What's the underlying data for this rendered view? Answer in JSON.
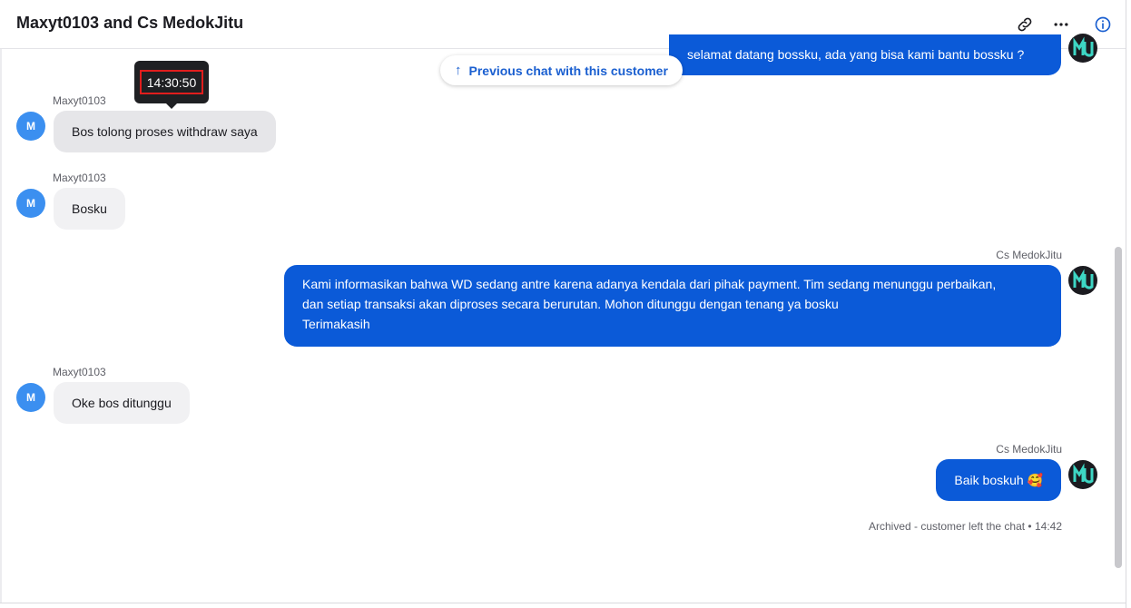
{
  "header": {
    "title": "Maxyt0103 and Cs MedokJitu"
  },
  "previous_chat": {
    "label": "Previous chat with this customer"
  },
  "tooltip": {
    "time": "14:30:50"
  },
  "messages": [
    {
      "author": "Cs MedokJitu",
      "text": "selamat datang bossku, ada yang bisa kami bantu bossku ?"
    },
    {
      "author": "Maxyt0103",
      "text": "Bos tolong proses withdraw saya"
    },
    {
      "author": "Maxyt0103",
      "text": "Bosku"
    },
    {
      "author": "Cs MedokJitu",
      "lines": [
        "Kami informasikan bahwa WD sedang antre karena adanya kendala dari pihak payment. Tim sedang menunggu perbaikan,",
        "dan setiap transaksi akan diproses secara berurutan. Mohon ditunggu dengan tenang ya bosku",
        "Terimakasih"
      ]
    },
    {
      "author": "Maxyt0103",
      "text": "Oke bos ditunggu"
    },
    {
      "author": "Cs MedokJitu",
      "text": "Baik boskuh 🥰"
    }
  ],
  "avatar_initial": "M",
  "footer_status": {
    "text": "Archived - customer left the chat",
    "time": "14:42"
  },
  "colors": {
    "agent_bubble": "#0b5ad8",
    "customer_bubble": "#f1f1f3",
    "avatar": "#3b8ff0",
    "link": "#1a5fd0",
    "highlight": "#e11d1d"
  },
  "icons": [
    "link-icon",
    "more-icon",
    "info-icon",
    "arrow-up-icon"
  ]
}
